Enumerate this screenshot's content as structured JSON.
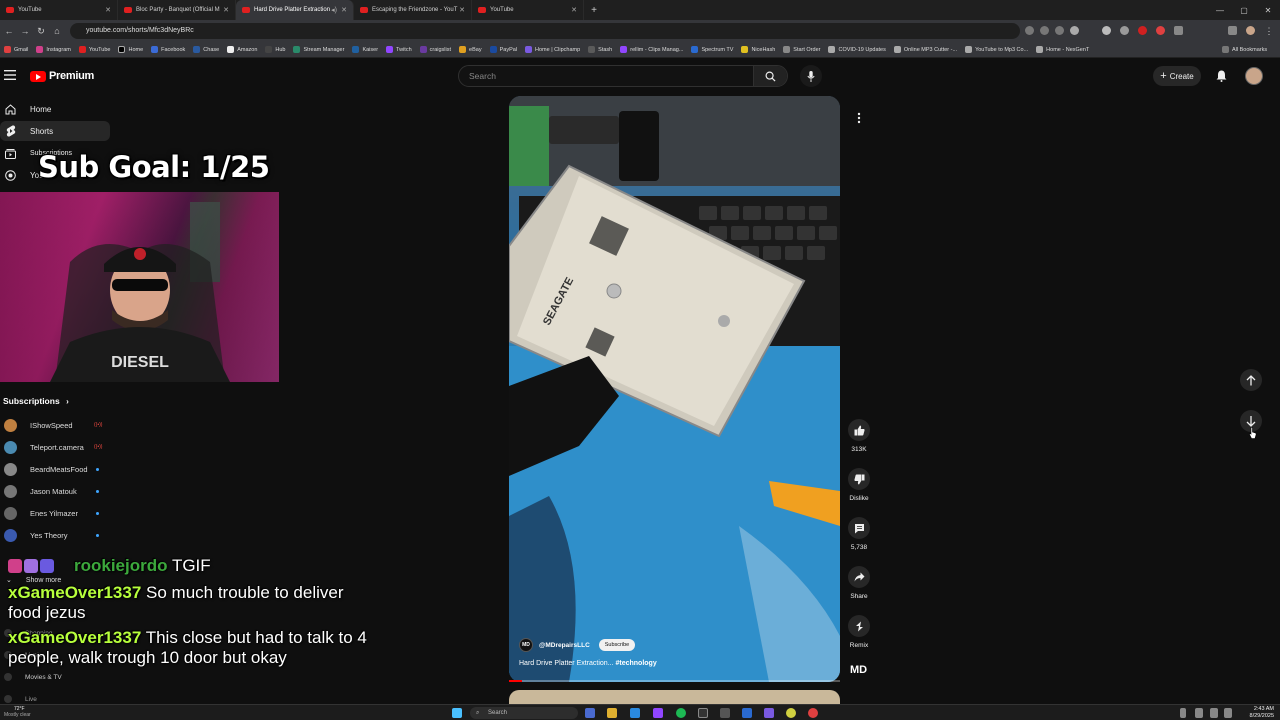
{
  "browser": {
    "tabs": [
      {
        "title": "YouTube",
        "active": false
      },
      {
        "title": "Bloc Party - Banquet (Official M",
        "active": false
      },
      {
        "title": "Hard Drive Platter Extraction",
        "active": true
      },
      {
        "title": "Escaping the Friendzone - YouT",
        "active": false
      },
      {
        "title": "YouTube",
        "active": false
      }
    ],
    "url": "youtube.com/shorts/Mfc3dNeyBRc",
    "bookmarks": [
      "Gmail",
      "Instagram",
      "YouTube",
      "Home",
      "Facebook",
      "Chase",
      "Amazon",
      "Hub",
      "Stream Manager",
      "Kaiser",
      "Twitch",
      "craigslist",
      "eBay",
      "PayPal",
      "Home | Clipchamp",
      "Stash",
      "rellim - Clips Manag...",
      "Spectrum TV",
      "NiceHash",
      "Start Order",
      "COVID-19 Updates",
      "Online MP3 Cutter -...",
      "YouTube to Mp3 Co...",
      "Home - NexGenT"
    ],
    "all_bookmarks": "All Bookmarks"
  },
  "header": {
    "logo_text": "Premium",
    "search_placeholder": "Search",
    "create_label": "Create"
  },
  "sidebar": {
    "items": [
      {
        "label": "Home",
        "icon": "home-icon"
      },
      {
        "label": "Shorts",
        "icon": "shorts-icon",
        "active": true
      },
      {
        "label": "Subscriptions",
        "icon": "subscriptions-icon"
      },
      {
        "label": "You",
        "icon": "you-icon"
      }
    ],
    "subscriptions_heading": "Subscriptions",
    "subscriptions": [
      {
        "name": "IShowSpeed",
        "status": "live",
        "color": "#c08040"
      },
      {
        "name": "Teleport.camera",
        "status": "live",
        "color": "#4a8ab0"
      },
      {
        "name": "BeardMeatsFood",
        "status": "dot",
        "color": "#888888"
      },
      {
        "name": "Jason Matouk",
        "status": "dot",
        "color": "#777777"
      },
      {
        "name": "Enes Yilmazer",
        "status": "dot",
        "color": "#666666"
      },
      {
        "name": "Yes Theory",
        "status": "dot",
        "color": "#3a5ab0"
      }
    ],
    "show_more": "Show more",
    "explore_partial": [
      "Shopping",
      "Music",
      "Movies & TV",
      "Live"
    ]
  },
  "overlay": {
    "sub_goal": "Sub Goal: 1/25",
    "chat": [
      {
        "user": "rookiejordo",
        "message": "TGIF"
      },
      {
        "user": "xGameOver1337",
        "message": "So much trouble to deliver food jezus"
      },
      {
        "user": "xGameOver1337",
        "message": "This close but had to talk to 4 people, walk trough 10 door but okay"
      }
    ]
  },
  "short": {
    "channel": "@MDrepairsLLC",
    "subscribe_label": "Subscribe",
    "title": "Hard Drive Platter Extraction...",
    "hashtag": "#technology",
    "progress": 0.04,
    "actions": [
      {
        "label": "313K",
        "icon": "like-icon"
      },
      {
        "label": "Dislike",
        "icon": "dislike-icon"
      },
      {
        "label": "5,738",
        "icon": "comment-icon"
      },
      {
        "label": "Share",
        "icon": "share-icon"
      },
      {
        "label": "Remix",
        "icon": "remix-icon"
      }
    ],
    "drive_brand": "SEAGATE"
  },
  "taskbar": {
    "temperature": "72°F",
    "weather": "Mostly clear",
    "search_label": "Search",
    "time": "2:43 AM",
    "date": "8/29/2025"
  }
}
